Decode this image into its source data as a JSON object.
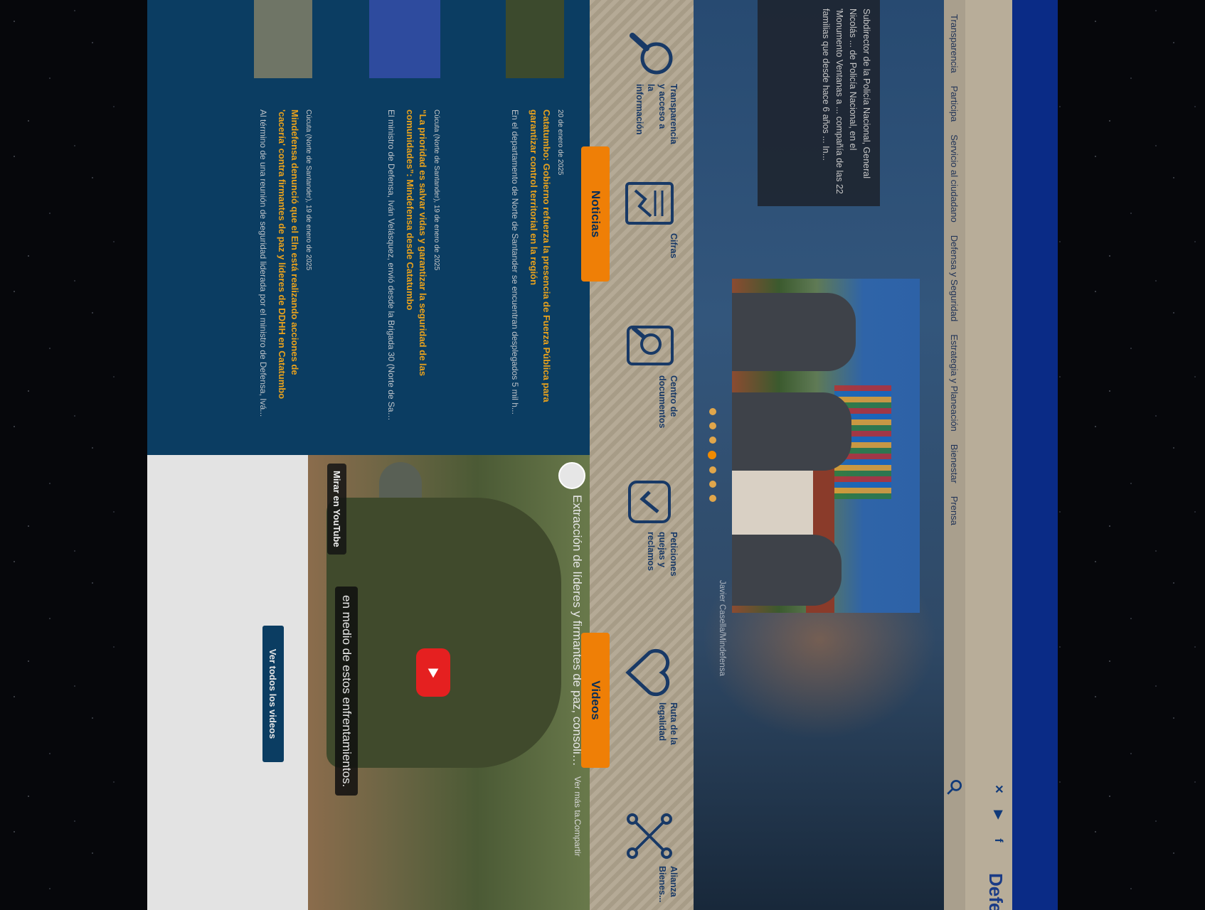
{
  "site": {
    "brand": "Defensa"
  },
  "nav": [
    "Transparencia",
    "Participa",
    "Servicio al ciudadano",
    "Defensa y Seguridad",
    "Estrategia y Planeación",
    "Bienestar",
    "Prensa"
  ],
  "hero": {
    "caption": "Subdirector de la Policía Nacional, General Nicolás ... de Policía Nacional, en el 'Monumento Ventanas a ... compañía de las 22 familias que desde hace 6 años ... In...",
    "photo_credit": "Javier Casella/Mindefensa",
    "slides_count": 7,
    "active_slide": 4
  },
  "quick_links": [
    {
      "label": "Transparencia y acceso a la información",
      "icon": "search-icon"
    },
    {
      "label": "Cifras",
      "icon": "document-chart-icon"
    },
    {
      "label": "Centro de documentos",
      "icon": "document-search-icon"
    },
    {
      "label": "Peticiones quejas y reclamos",
      "icon": "hand-check-icon"
    },
    {
      "label": "Ruta de la legalidad",
      "icon": "heart-icon"
    },
    {
      "label": "Alianza Bienes...",
      "icon": "network-icon"
    }
  ],
  "news": {
    "title": "Noticias",
    "items": [
      {
        "date": "20 de enero de 2025",
        "title": "Catatumbo: Gobierno refuerza la presencia de Fuerza Pública para garantizar control territorial en la región",
        "excerpt": "En el departamento de Norte de Santander se encuentran desplegados 5 mil h..."
      },
      {
        "date": "Cúcuta (Norte de Santander), 19 de enero de 2025",
        "title": "“La prioridad es salvar vidas y garantizar la seguridad de las comunidades”: Mindefensa desde Catatumbo",
        "excerpt": "El ministro de Defensa, Iván Velásquez, envió desde la Brigada 30 (Norte de San..."
      },
      {
        "date": "Cúcuta (Norte de Santander), 19 de enero de 2025",
        "title": "Mindefensa denunció que el Eln está realizando acciones de 'cacería' contra firmantes de paz y líderes de DDHH en Catatumbo",
        "excerpt": "Al término de una reunión de seguridad liderada por el ministro de Defensa, Ivá..."
      }
    ]
  },
  "videos": {
    "title": "Videos",
    "video_title": "Extracción de líderes y firmantes de paz, consolidació...",
    "more": "Ver más ta...",
    "share": "Compartir",
    "caption": "en medio de estos enfrentamientos.",
    "watch_on": "Mirar en  YouTube",
    "see_all": "Ver todos los videos"
  }
}
